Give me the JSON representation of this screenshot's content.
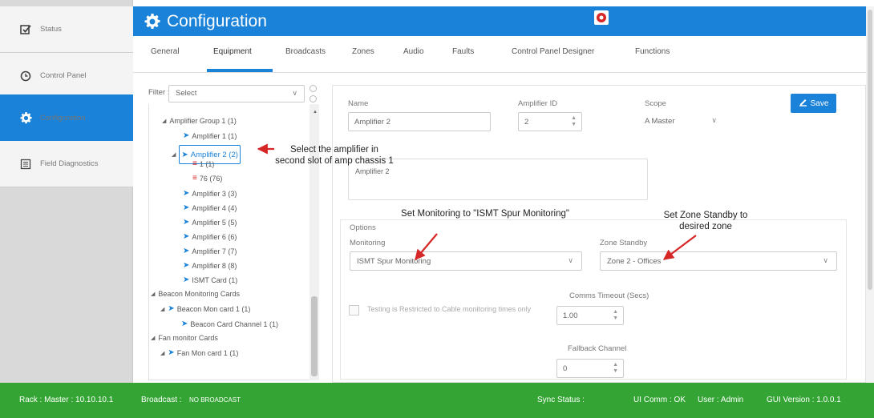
{
  "nav": {
    "status": "Status",
    "control_panel": "Control Panel",
    "configuration": "Configuration",
    "field_diagnostics": "Field Diagnostics"
  },
  "header": {
    "title": "Configuration"
  },
  "tabs": [
    "General",
    "Equipment",
    "Broadcasts",
    "Zones",
    "Audio",
    "Faults",
    "Control Panel Designer",
    "Functions"
  ],
  "filter": {
    "label": "Filter :",
    "value": "Select"
  },
  "tree": {
    "group1": "Amplifier Group 1 (1)",
    "amp1": "Amplifier 1 (1)",
    "amp2": "Amplifier 2 (2)",
    "ch1": "1 (1)",
    "ch76": "76 (76)",
    "amp3": "Amplifier 3 (3)",
    "amp4": "Amplifier 4 (4)",
    "amp5": "Amplifier 5 (5)",
    "amp6": "Amplifier 6 (6)",
    "amp7": "Amplifier 7 (7)",
    "amp8": "Amplifier 8 (8)",
    "ismt": "ISMT Card (1)",
    "beacon_group": "Beacon Monitoring Cards",
    "beacon_card": "Beacon Mon card 1 (1)",
    "beacon_channel": "Beacon Card Channel 1 (1)",
    "fan_group": "Fan monitor Cards",
    "fan_card": "Fan Mon card 1 (1)"
  },
  "annotations": {
    "select_amp": "Select the amplifier in second slot of amp chassis 1",
    "monitoring": "Set Monitoring to \"ISMT Spur Monitoring\"",
    "zone_standby": "Set Zone Standby to desired zone"
  },
  "form": {
    "name_label": "Name",
    "name_value": "Amplifier 2",
    "amp_id_label": "Amplifier ID",
    "amp_id_value": "2",
    "scope_label": "Scope",
    "scope_value": "A Master",
    "save_label": "Save",
    "description_value": "Amplifier 2",
    "options_label": "Options",
    "monitoring_label": "Monitoring",
    "monitoring_value": "ISMT Spur Monitoring",
    "zone_standby_label": "Zone Standby",
    "zone_standby_value": "Zone 2 - Offices",
    "testing_label": "Testing is Restricted to Cable monitoring times only",
    "comms_timeout_label": "Comms Timeout (Secs)",
    "comms_timeout_value": "1.00",
    "fallback_label": "Fallback Channel",
    "fallback_value": "0"
  },
  "footer": {
    "rack": "Rack : Master : 10.10.10.1",
    "broadcast_label": "Broadcast :",
    "broadcast_value": "NO BROADCAST",
    "sync_status": "Sync Status :",
    "ui_comm": "UI Comm : OK",
    "user": "User : Admin",
    "gui_version": "GUI Version : 1.0.0.1"
  },
  "colors": {
    "accent": "#1a82d8",
    "footer": "#34a534",
    "alert": "#d62626"
  }
}
